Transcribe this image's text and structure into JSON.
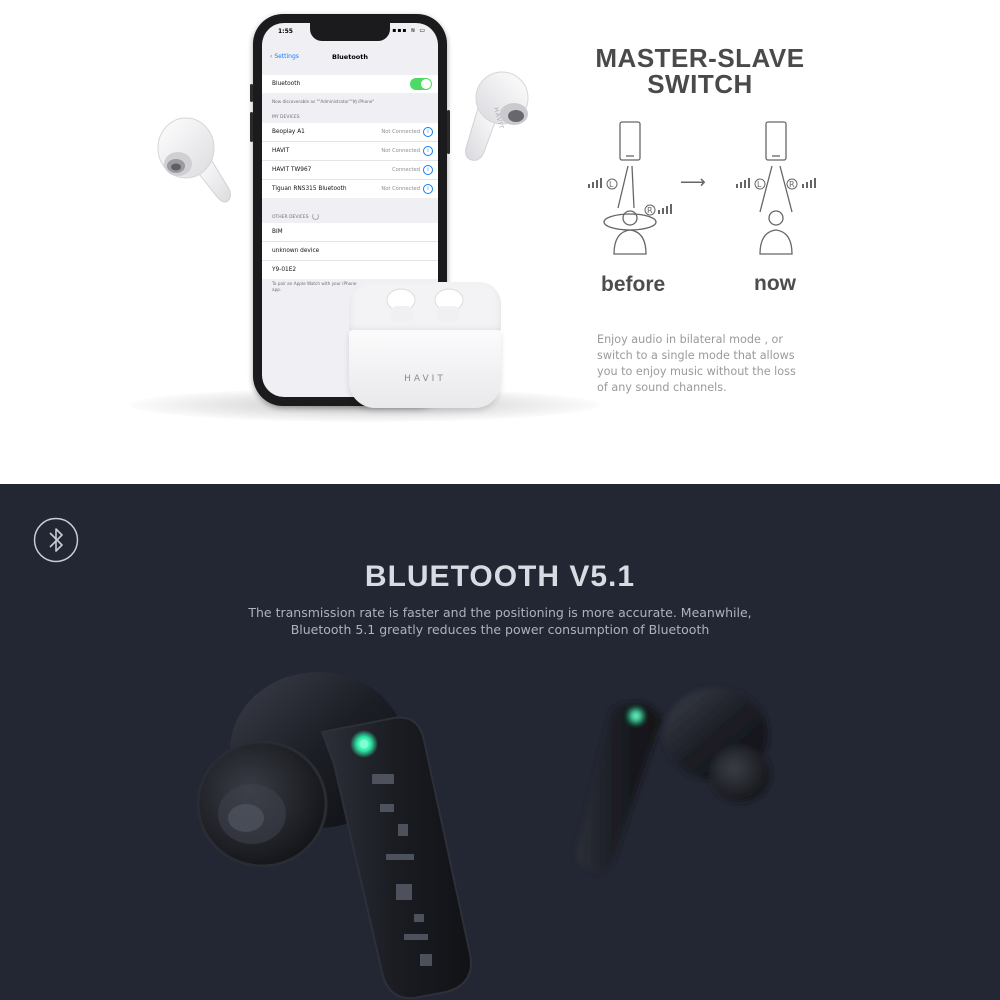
{
  "phone": {
    "status_time": "1:55",
    "status_right": "▪▪▪ ≋ ▭",
    "nav_back": "Settings",
    "nav_title": "Bluetooth",
    "bluetooth_row": {
      "label": "Bluetooth",
      "enabled": true
    },
    "discoverable_note": "Now discoverable as \"\"Administrator\"\"的 iPhone\"",
    "my_devices_header": "MY DEVICES",
    "my_devices": [
      {
        "name": "Beoplay A1",
        "status": "Not Connected"
      },
      {
        "name": "HAVIT",
        "status": "Not Connected"
      },
      {
        "name": "HAVIT  TW967",
        "status": "Connected"
      },
      {
        "name": "Tiguan RNS315 Bluetooth",
        "status": "Not Connected"
      }
    ],
    "other_devices_header": "OTHER DEVICES",
    "other_devices": [
      {
        "name": "BIM"
      },
      {
        "name": "unknown device"
      },
      {
        "name": "Y9-01E2"
      }
    ],
    "pair_note_line1": "To pair an Apple Watch with your iPhone",
    "pair_note_line2": "app."
  },
  "product": {
    "case_logo": "HAVIT",
    "bud_logo": "HAVIT"
  },
  "master_slave": {
    "title_line1": "MASTER-SLAVE",
    "title_line2": "SWITCH",
    "before_label": "before",
    "now_label": "now",
    "left_channel": "L",
    "right_channel": "R",
    "arrow": "⟶",
    "description_lines": [
      "Enjoy audio in bilateral mode , or",
      "switch to a single mode that allows",
      "you to enjoy music without the loss",
      "of any sound channels."
    ]
  },
  "bluetooth": {
    "title": "BLUETOOTH V5.1",
    "description_lines": [
      "The transmission rate is faster and the positioning is more accurate. Meanwhile,",
      "Bluetooth 5.1 greatly reduces the power consumption of Bluetooth"
    ]
  },
  "colors": {
    "dark_background": "#232633",
    "toggle_green": "#4cd964",
    "ios_blue": "#147efb",
    "led_green": "#2ee8a6"
  },
  "icons": [
    "bluetooth-icon",
    "smartphone-icon",
    "person-icon",
    "signal-bars-icon",
    "info-icon",
    "back-chevron-icon",
    "arrow-right-icon"
  ]
}
